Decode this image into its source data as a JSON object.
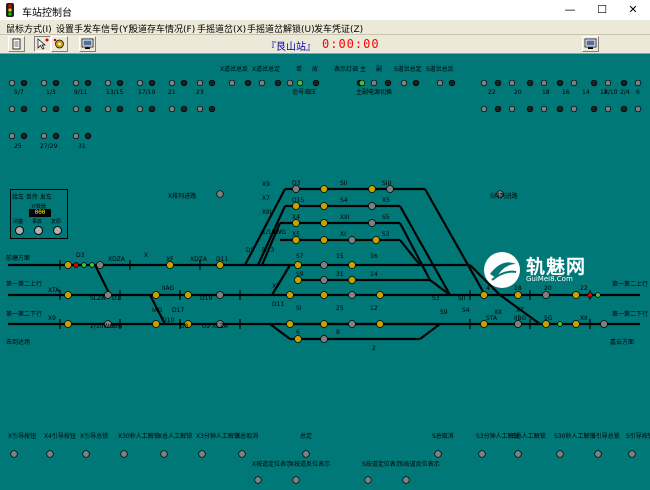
{
  "window": {
    "title": "车站控制台",
    "minimize": "—",
    "maximize": "☐",
    "close": "✕"
  },
  "menu": [
    "鼠标方式(I)",
    "设置手发车信号(Y)",
    "股道存车情况(F)",
    "手摇道岔(X)",
    "手摇道岔解锁(U)",
    "发车凭证(Z)"
  ],
  "toolbar": {
    "station": "『艮山站』",
    "clock": "0:00:00",
    "icons": [
      "document-icon",
      "mouse-cursor-icon",
      "gear-icon",
      "screen-icon",
      "screen-icon"
    ]
  },
  "panel": {
    "header": "接车 单传 发车",
    "counter_label": "计数器",
    "counter_value": "000",
    "button_labels": [
      "闭塞",
      "事故",
      "复原"
    ]
  },
  "top_labels": {
    "row1": [
      "X道岔总反",
      "X道岔总定",
      "单",
      "故",
      "表示灯调",
      "主",
      "副",
      "S道岔总定",
      "S道岔总反"
    ],
    "row2": [
      "信号调压",
      "主副电源切换"
    ],
    "numbers": [
      "5/7",
      "1/3",
      "9/11",
      "13/15",
      "17/19",
      "21",
      "23",
      "22",
      "20",
      "18",
      "16",
      "14",
      "12",
      "8/10",
      "2/4",
      "6",
      "25",
      "27/29",
      "31"
    ]
  },
  "track_labels": {
    "left": [
      "前塘方面",
      "第一第二上行",
      "第一第二下行",
      "去到达场"
    ],
    "right": [
      "第一第二上行",
      "第一第二下行",
      "嘉云方面"
    ],
    "routes": [
      "X排列进路",
      "S排列进路"
    ],
    "signals": [
      "X",
      "XF",
      "XDZA",
      "D11",
      "D3",
      "D13",
      "D5",
      "1/19WG",
      "D15",
      "X4",
      "X5",
      "S5",
      "S3",
      "S7",
      "S9",
      "SI",
      "SII",
      "SIII",
      "S4",
      "XI",
      "XII",
      "XIII",
      "X7",
      "X9",
      "XTA",
      "SLZA",
      "D1",
      "IIAG",
      "IAG",
      "D17",
      "D19",
      "D10",
      "D8",
      "D2",
      "XLZA",
      "STA",
      "2/10WG",
      "IIBG",
      "IBG",
      "5G",
      "6G",
      "7G",
      "8G",
      "I6",
      "II6",
      "IIIG",
      "IG",
      "IIG",
      "4G",
      "X6",
      "S6"
    ],
    "numbers": [
      "7",
      "13",
      "11",
      "29",
      "19",
      "17",
      "27",
      "23",
      "21",
      "9",
      "1",
      "3",
      "15",
      "31",
      "25",
      "16",
      "14",
      "12",
      "6",
      "8",
      "2",
      "4",
      "18",
      "20",
      "22",
      "24",
      "26",
      "28"
    ]
  },
  "bottom_buttons": {
    "row1": [
      "X引导按钮",
      "X4引导按钮",
      "X引导总锁",
      "X30秒人工解锁",
      "X总人工解锁",
      "X3分钟人工解锁",
      "X总取消",
      "总定",
      "S总取消",
      "S3分钟人工解锁",
      "S总人工解锁",
      "S30秒人工解锁",
      "S引导总锁",
      "S引导按钮"
    ],
    "row2": [
      "X按道定位表示",
      "X按道反位表示",
      "S按道定位表示",
      "S按道反位表示"
    ]
  },
  "watermark": {
    "text": "轨魅网",
    "url": "GuiMei8.Com"
  },
  "colors": {
    "canvas": "#007878",
    "track": "#000000",
    "lamp_gray": "#808080",
    "lamp_yellow": "#c8a000",
    "lamp_green": "#40c040",
    "lamp_red": "#e00000",
    "title_red": "#ff0000",
    "station_blue": "#0000aa"
  }
}
